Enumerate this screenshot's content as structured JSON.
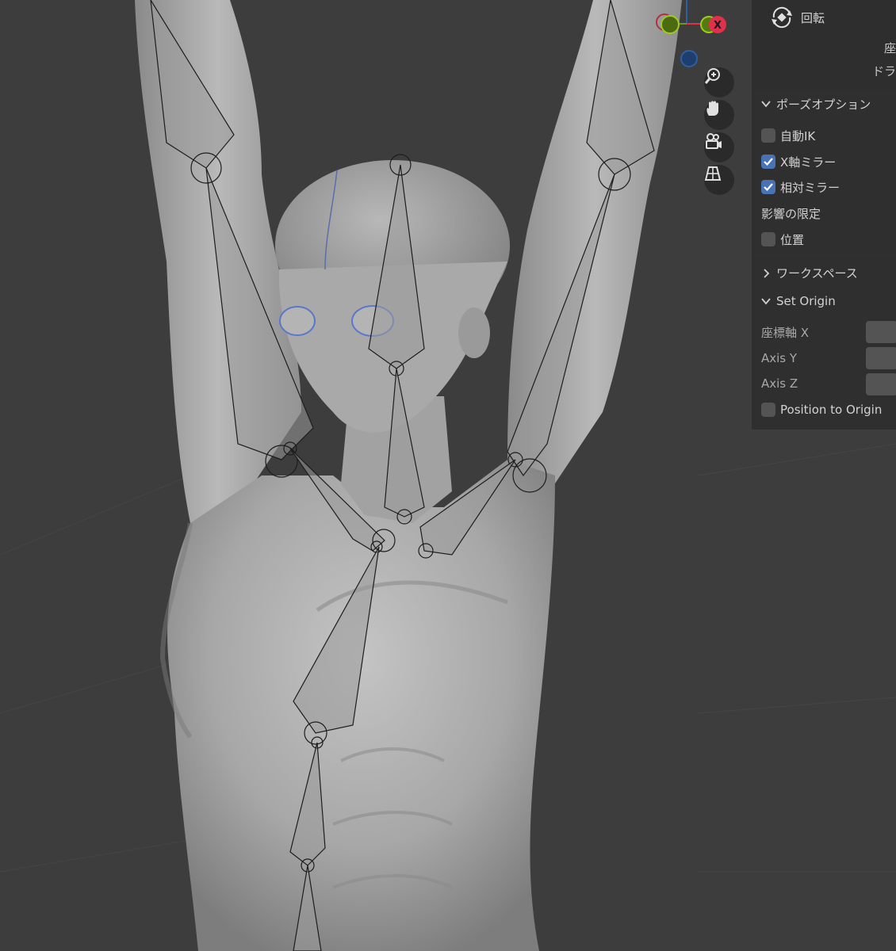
{
  "gizmo": {
    "x_axis_label": "X"
  },
  "navigation": {
    "buttons": [
      "zoom-icon",
      "hand-pan-icon",
      "camera-icon",
      "grid-view-icon"
    ]
  },
  "panel": {
    "rotate_label": "回転",
    "truncated_line_1": "座",
    "truncated_line_2": "ドラ",
    "pose_options": {
      "title": "ポーズオプション",
      "auto_ik": {
        "label": "自動IK",
        "checked": false
      },
      "x_mirror": {
        "label": "X軸ミラー",
        "checked": true
      },
      "relative_mirror": {
        "label": "相対ミラー",
        "checked": true
      },
      "affect_limit_label": "影響の限定",
      "location": {
        "label": "位置",
        "checked": false
      }
    },
    "workspace": {
      "title": "ワークスペース"
    },
    "set_origin": {
      "title": "Set Origin",
      "axis_x_label": "座標軸 X",
      "axis_y_label": "Axis Y",
      "axis_z_label": "Axis Z",
      "position_to_origin": {
        "label": "Position to Origin",
        "checked": false
      }
    }
  },
  "colors": {
    "viewport_bg": "#3d3d3d",
    "panel_bg": "#2e2e2e",
    "checkbox_on": "#4772b3",
    "axis_x": "#e0304b",
    "axis_y": "#6a9a1a",
    "axis_z": "#2f5fa0"
  }
}
